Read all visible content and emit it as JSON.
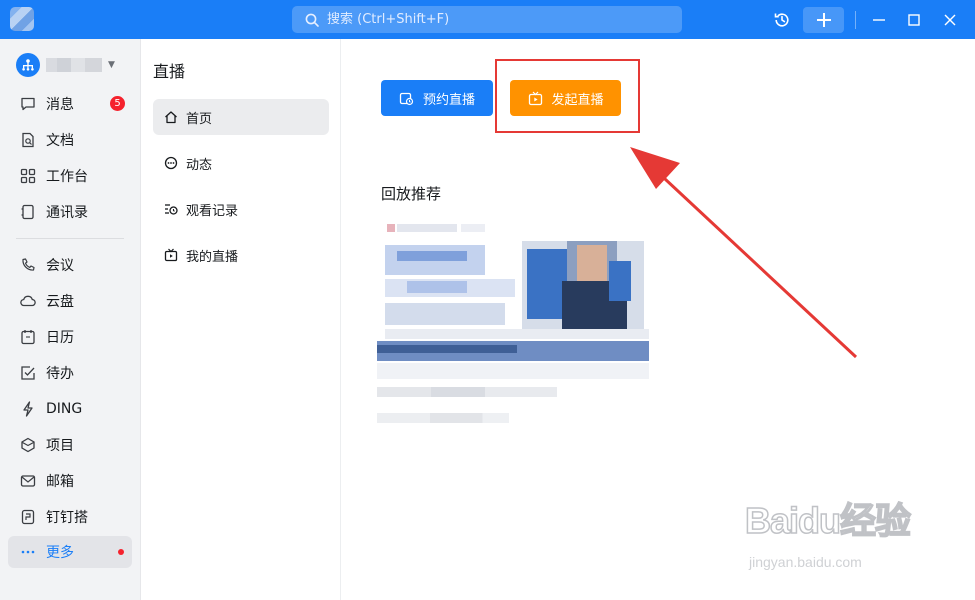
{
  "search": {
    "placeholder": "搜索 (Ctrl+Shift+F)"
  },
  "sidebar": {
    "items": [
      {
        "label": "消息",
        "icon": "message-icon",
        "badge": "5"
      },
      {
        "label": "文档",
        "icon": "document-icon"
      },
      {
        "label": "工作台",
        "icon": "workbench-icon"
      },
      {
        "label": "通讯录",
        "icon": "contacts-icon"
      },
      {
        "label": "会议",
        "icon": "meeting-icon"
      },
      {
        "label": "云盘",
        "icon": "cloud-drive-icon"
      },
      {
        "label": "日历",
        "icon": "calendar-icon"
      },
      {
        "label": "待办",
        "icon": "todo-icon"
      },
      {
        "label": "DING",
        "icon": "ding-icon"
      },
      {
        "label": "项目",
        "icon": "project-icon"
      },
      {
        "label": "邮箱",
        "icon": "mail-icon"
      },
      {
        "label": "钉钉搭",
        "icon": "dingda-icon"
      },
      {
        "label": "更多",
        "icon": "more-icon"
      }
    ]
  },
  "live": {
    "title": "直播",
    "menu": [
      {
        "label": "首页",
        "icon": "home-icon"
      },
      {
        "label": "动态",
        "icon": "feed-icon"
      },
      {
        "label": "观看记录",
        "icon": "watch-history-icon"
      },
      {
        "label": "我的直播",
        "icon": "my-live-icon"
      }
    ],
    "reserve_label": "预约直播",
    "start_label": "发起直播",
    "replay_title": "回放推荐"
  },
  "watermark": {
    "brand": "Baidu经验",
    "url": "jingyan.baidu.com"
  },
  "colors": {
    "primary": "#1a7ef7",
    "orange": "#ff9200",
    "red": "#e53935"
  }
}
